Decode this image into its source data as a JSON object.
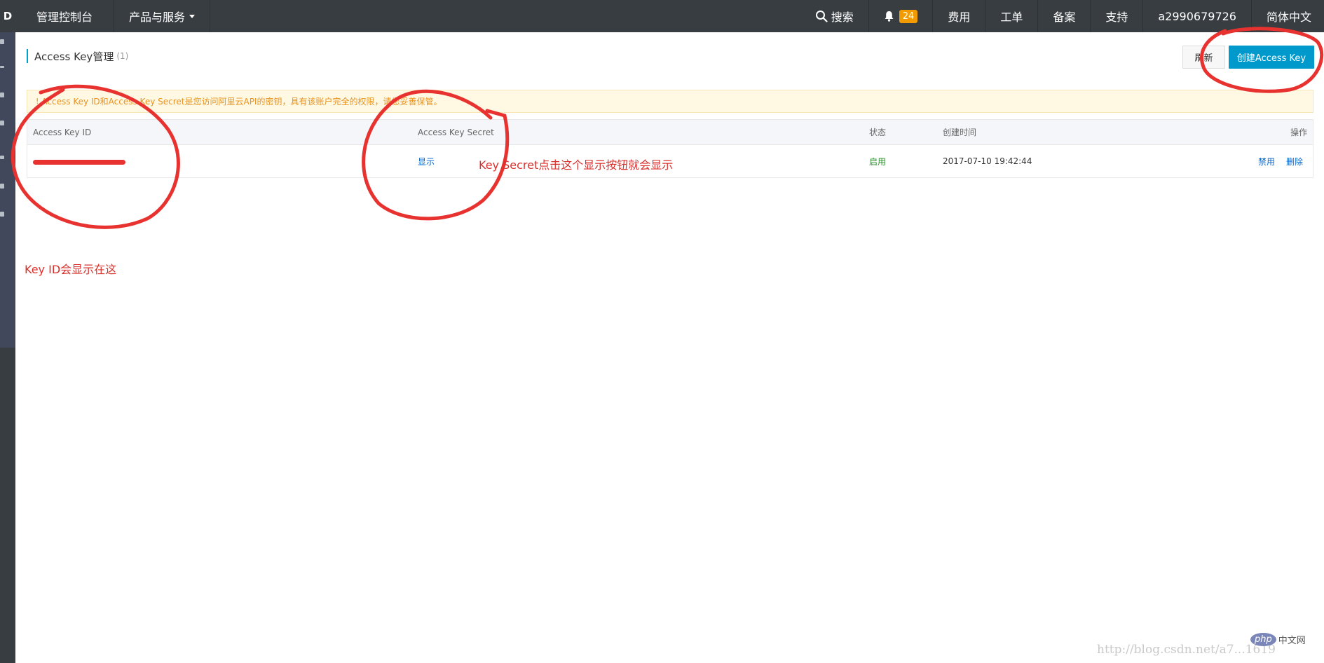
{
  "topbar": {
    "logo": "D",
    "console": "管理控制台",
    "products": "产品与服务",
    "search": "搜索",
    "notifications": "24",
    "billing": "费用",
    "tickets": "工单",
    "icp": "备案",
    "support": "支持",
    "account": "a2990679726",
    "language": "简体中文"
  },
  "page": {
    "title": "Access Key管理",
    "count": "(1)",
    "refresh_label": "刷新",
    "create_label": "创建Access Key"
  },
  "notice": {
    "icon": "!",
    "text": "Access Key ID和Access Key Secret是您访问阿里云API的密钥，具有该账户完全的权限，请您妥善保管。"
  },
  "table": {
    "headers": {
      "id": "Access Key ID",
      "secret": "Access Key Secret",
      "status": "状态",
      "created": "创建时间",
      "ops": "操作"
    },
    "rows": [
      {
        "secret_link": "显示",
        "status": "启用",
        "created": "2017-07-10 19:42:44",
        "disable": "禁用",
        "delete": "删除"
      }
    ]
  },
  "annotations": {
    "secret_note": "Key Secret点击这个显示按钮就会显示",
    "keyid_note": "Key ID会显示在这"
  },
  "watermark": {
    "url": "http://blog.csdn.net/a7...1619",
    "php": "php",
    "php_suffix": "中文网"
  },
  "colors": {
    "topbar": "#373d41",
    "primary": "#0099cc",
    "warning_bg": "#fff8e3",
    "warning_text": "#e8931d",
    "annotation": "#e8322f"
  }
}
